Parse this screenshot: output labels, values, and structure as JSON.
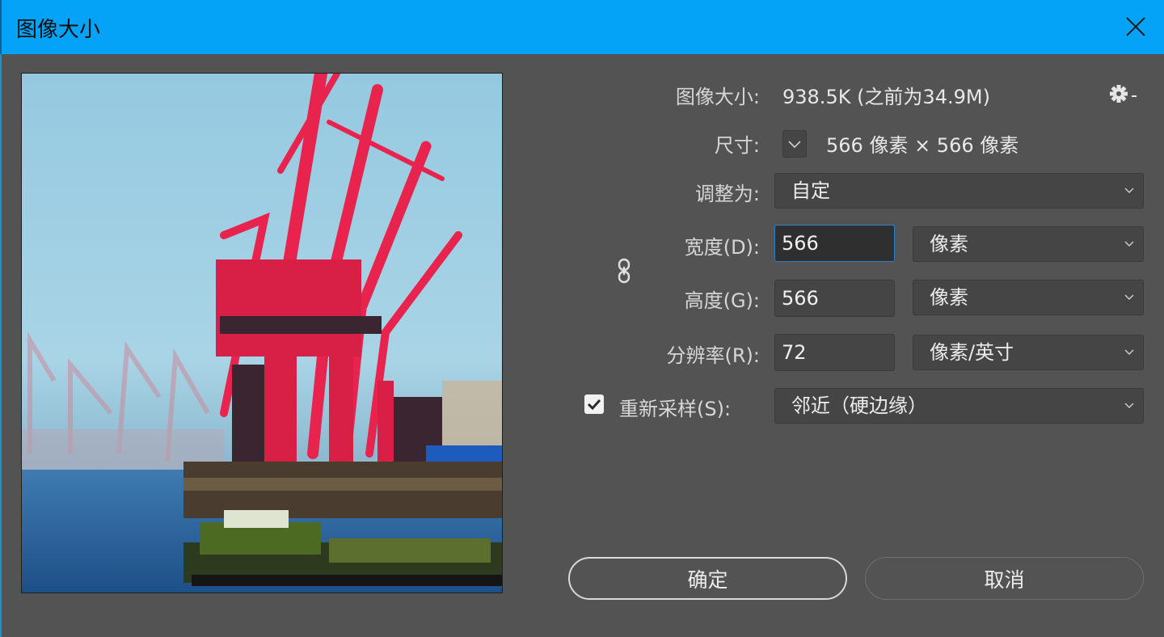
{
  "window": {
    "title": "图像大小"
  },
  "info": {
    "size_label": "图像大小:",
    "size_value": "938.5K (之前为34.9M)",
    "dims_label": "尺寸:",
    "dims_value": "566 像素  ×  566 像素"
  },
  "fit": {
    "label": "调整为:",
    "value": "自定"
  },
  "width": {
    "label": "宽度(D):",
    "value": "566",
    "unit": "像素"
  },
  "height": {
    "label": "高度(G):",
    "value": "566",
    "unit": "像素"
  },
  "resolution": {
    "label": "分辨率(R):",
    "value": "72",
    "unit": "像素/英寸"
  },
  "resample": {
    "label": "重新采样(S):",
    "checked": true,
    "value": "邻近（硬边缘）"
  },
  "buttons": {
    "ok": "确定",
    "cancel": "取消"
  },
  "icons": {
    "close": "close-icon",
    "gear": "gear-icon",
    "link": "link-icon",
    "checkmark": "checkmark-icon",
    "chevron": "chevron-down-icon"
  },
  "colors": {
    "titlebar": "#04a3f7",
    "background": "#535353",
    "focus": "#2d7fc9"
  }
}
